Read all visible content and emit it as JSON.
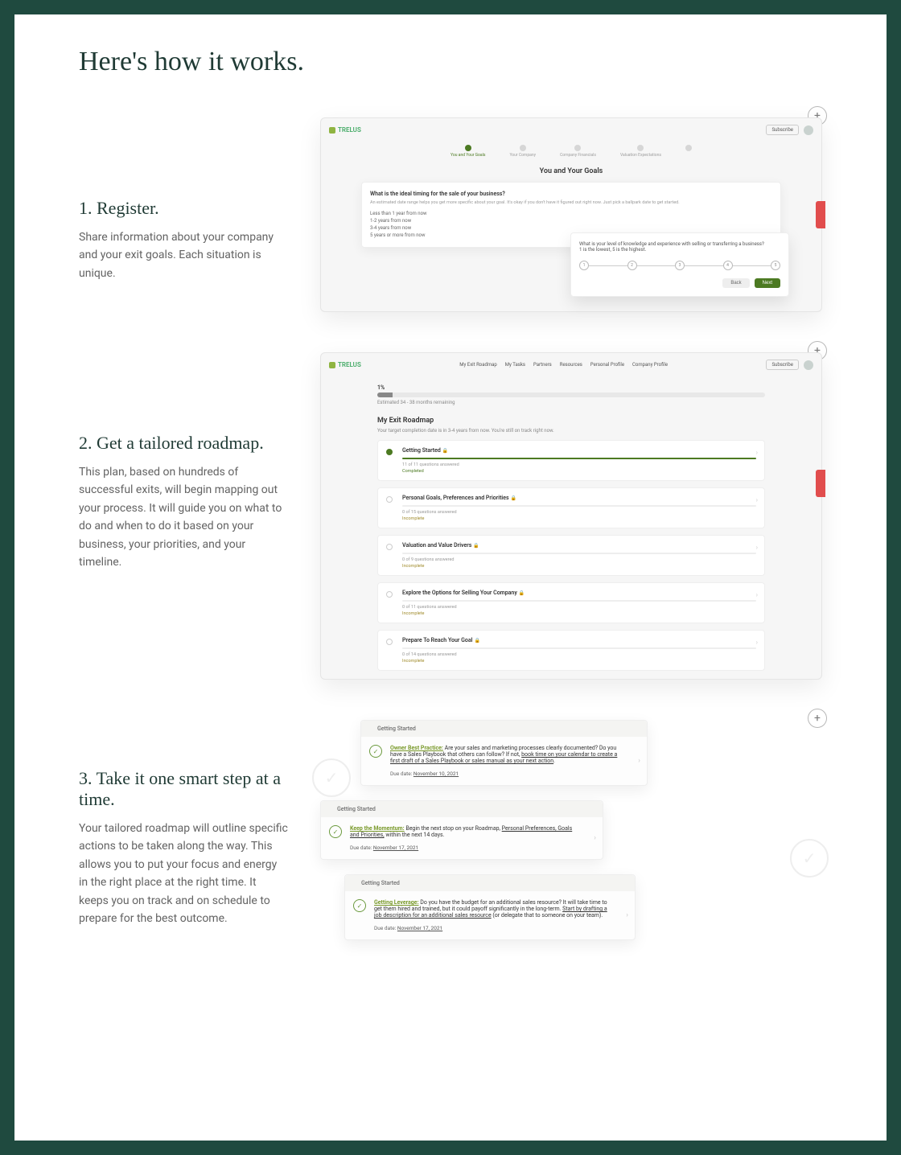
{
  "title": "Here's how it works.",
  "steps": [
    {
      "title": "1. Register.",
      "body": "Share information about your company and your exit goals. Each situation is unique."
    },
    {
      "title": "2. Get a tailored roadmap.",
      "body": "This plan, based on hundreds of successful exits, will begin mapping out your process. It will guide you on what to do and when to do it based on your business, your priorities, and your timeline."
    },
    {
      "title": "3. Take it one smart step at a time.",
      "body": "Your tailored roadmap will outline specific actions to be taken along the way. This allows you to put your focus and energy in the right place at the right time. It keeps you on track and on schedule to prepare for the best outcome."
    }
  ],
  "app": {
    "logo": "TRELUS",
    "subscribe": "Subscribe",
    "nav": [
      "My Exit Roadmap",
      "My Tasks",
      "Partners",
      "Resources",
      "Personal Profile",
      "Company Profile"
    ]
  },
  "mock1": {
    "stepper": [
      "You and Your Goals",
      "Your Company",
      "Company Financials",
      "Valuation Expectations",
      ""
    ],
    "heading": "You and Your Goals",
    "card1": {
      "q": "What is the ideal timing for the sale of your business?",
      "sub": "An estimated date range helps you get more specific about your goal. It's okay if you don't have it figured out right now. Just pick a ballpark date to get started.",
      "opts": [
        "Less than 1 year from now",
        "1-2 years from now",
        "3-4 years from now",
        "5 years or more from now"
      ]
    },
    "card2": {
      "q": "What is your level of knowledge and experience with selling or transferring a business?",
      "sub": "1 is the lowest, 5 is the highest.",
      "back": "Back",
      "next": "Next"
    }
  },
  "mock2": {
    "progress_label": "1%",
    "progress_sub": "Estimated 34 - 38 months remaining",
    "title": "My Exit Roadmap",
    "sub": "Your target completion date is in 3-4 years from now. You're still on track right now.",
    "stages": [
      {
        "t": "Getting Started",
        "meta": "11 of 11 questions answered",
        "status": "Completed"
      },
      {
        "t": "Personal Goals, Preferences and Priorities",
        "meta": "0 of 15 questions answered",
        "status": "Incomplete"
      },
      {
        "t": "Valuation and Value Drivers",
        "meta": "0 of 9 questions answered",
        "status": "Incomplete"
      },
      {
        "t": "Explore the Options for Selling Your Company",
        "meta": "0 of 11 questions answered",
        "status": "Incomplete"
      },
      {
        "t": "Prepare To Reach Your Goal",
        "meta": "0 of 14 questions answered",
        "status": "Incomplete"
      }
    ]
  },
  "mock3": {
    "head": "Getting Started",
    "tasks": [
      {
        "lbl": "Owner Best Practice:",
        "txt": " Are your sales and marketing processes clearly documented? Do you have a Sales Playbook that others can follow? If not, ",
        "u": "book time on your calendar to create a first draft of a Sales Playbook or sales manual as your next action",
        "tail": ".",
        "due": "Due date: ",
        "date": "November 10, 2021"
      },
      {
        "lbl": "Keep the Momentum:",
        "txt": " Begin the next stop on your Roadmap, ",
        "u": "Personal Preferences, Goals and Priorities,",
        "tail": " within the next 14 days.",
        "due": "Due date: ",
        "date": "November 17, 2021"
      },
      {
        "lbl": "Getting Leverage:",
        "txt": " Do you have the budget for an additional sales resource? It will take time to get them hired and trained, but it could payoff significantly in the long-term. ",
        "u": "Start by drafting a job description for an additional sales resource",
        "tail": " (or delegate that to someone on your team).",
        "due": "Due date: ",
        "date": "November 17, 2021"
      }
    ]
  }
}
